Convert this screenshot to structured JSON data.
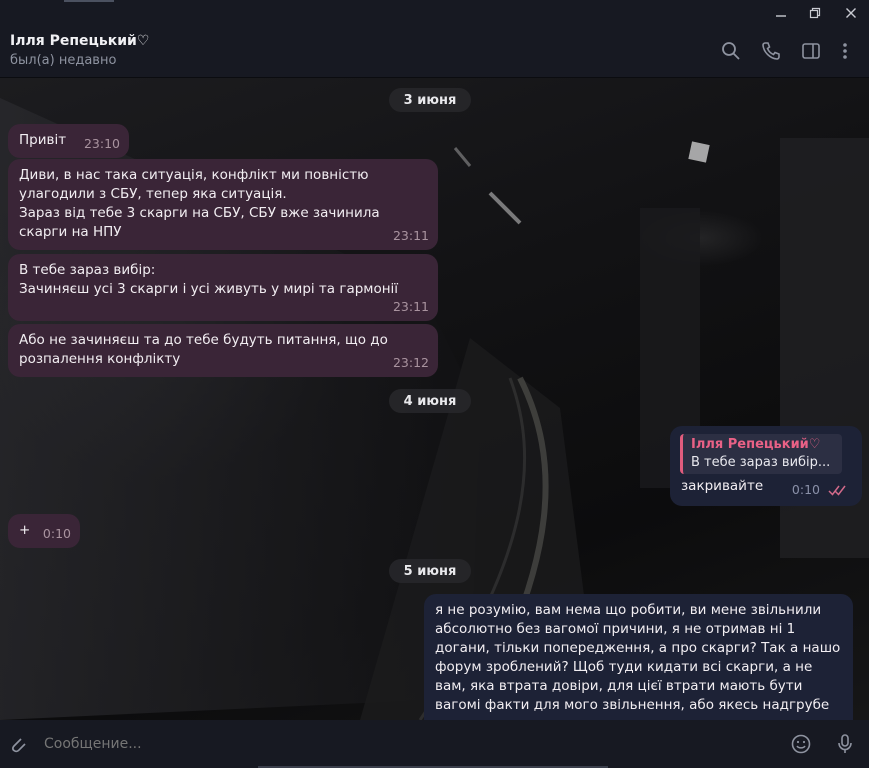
{
  "header": {
    "contact_name": "Ілля Репецький♡",
    "status": "был(а) недавно",
    "icons": [
      "search-icon",
      "phone-icon",
      "sidebar-icon",
      "more-icon"
    ]
  },
  "window": {
    "controls": [
      "minimize-icon",
      "restore-icon",
      "close-icon"
    ]
  },
  "dates": [
    "3 июня",
    "4 июня",
    "5 июня"
  ],
  "messages": [
    {
      "text": "Привіт",
      "time": "23:10"
    },
    {
      "text": "Диви, в нас така ситуація, конфлікт ми повністю\nулагодили з СБУ, тепер яка ситуація.\nЗараз від тебе 3 скарги на СБУ, СБУ вже зачинила\nскарги на НПУ",
      "time": "23:11"
    },
    {
      "text": "В тебе зараз вибір:\nЗачиняєш усі 3 скарги і усі живуть у мирі та гармонії",
      "time": "23:11"
    },
    {
      "text": "Або не зачиняєш та до тебе будуть питання, що до\nрозпалення конфлікту",
      "time": "23:12"
    },
    {
      "reply_name": "Ілля Репецький♡",
      "reply_text": "В тебе зараз вибір...",
      "text": "закривайте",
      "time": "0:10"
    },
    {
      "text": "+",
      "time": "0:10"
    },
    {
      "text": "я не розумію, вам нема що робити, ви мене звільнили\nабсолютно без вагомої причини, я не отримав ні 1\nдогани, тільки попередження, а про скарги? Так а нашо\nфорум зроблений? Щоб туди кидати всі скарги, а не\nвам, яка втрата довіри, для цієї втрати мають бути\nвагомі факти для мого звільнення, або якесь надгрубе"
    }
  ],
  "composer": {
    "placeholder": "Сообщение..."
  },
  "colors": {
    "incoming_bubble": "#3a2537",
    "outgoing_bubble": "#1d2236",
    "reply_accent": "#e05c7d",
    "read_check": "#d26a8a"
  }
}
